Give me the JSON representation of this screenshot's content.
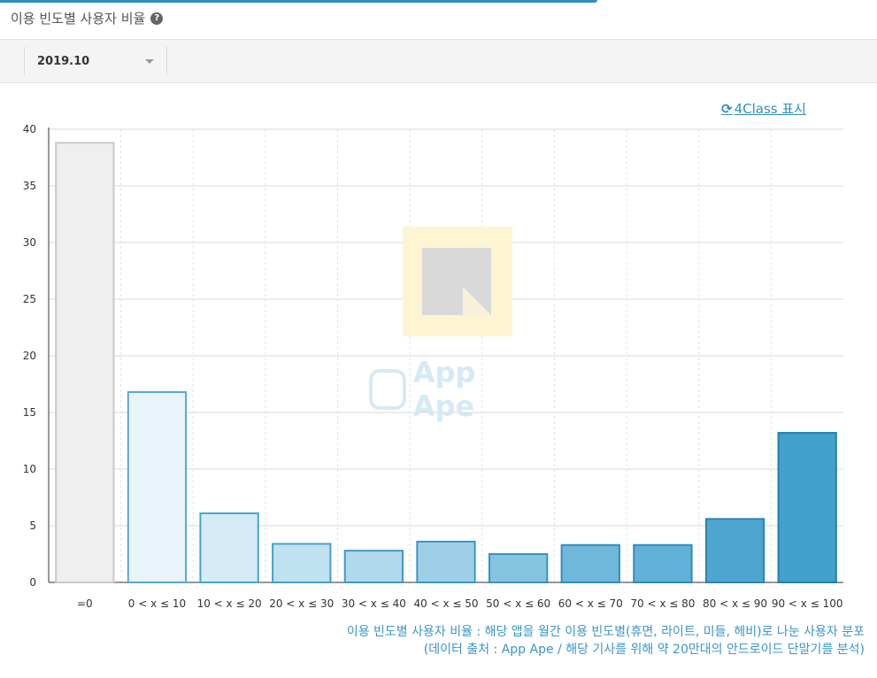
{
  "header": {
    "title": "이용 빈도별 사용자 비율",
    "help_icon": "?"
  },
  "toolbar": {
    "period_value": "2019.10"
  },
  "class_toggle": {
    "icon": "⟳",
    "label": "4Class 표시"
  },
  "watermark": {
    "logo_text": "App Ape"
  },
  "caption": {
    "line1": "이용 빈도별 사용자 비율 : 해당 앱을 월간 이용 빈도별(휴면, 라이트, 미들, 헤비)로 나눈 사용자 분포",
    "line2": "(데이터 출처 : App Ape / 해당 기사를 위해 약 20만대의 안드로이드 단말기를 분석)"
  },
  "chart_data": {
    "type": "bar",
    "title": "",
    "xlabel": "",
    "ylabel": "",
    "ylim": [
      0,
      40
    ],
    "yticks": [
      0,
      5,
      10,
      15,
      20,
      25,
      30,
      35,
      40
    ],
    "grid": true,
    "categories": [
      "=0",
      "0 < x ≤ 10",
      "10 < x ≤ 20",
      "20 < x ≤ 30",
      "30 < x ≤ 40",
      "40 < x ≤ 50",
      "50 < x ≤ 60",
      "60 < x ≤ 70",
      "70 < x ≤ 80",
      "80 < x ≤ 90",
      "90 < x ≤ 100"
    ],
    "values": [
      38.8,
      16.8,
      6.1,
      3.4,
      2.8,
      3.6,
      2.5,
      3.3,
      3.3,
      5.6,
      13.2
    ],
    "colors": [
      "#efefef",
      "#e8f4fa",
      "#d5ebf5",
      "#c0e1f0",
      "#b0d9ec",
      "#9ecfe7",
      "#86c3e0",
      "#70b8db",
      "#62b1d8",
      "#4ea6d0",
      "#41a0cc"
    ],
    "borders": [
      "#c9c9c9",
      "#55a9cf",
      "#4aa3cb",
      "#46a0c9",
      "#3f9ac4",
      "#3c97c2",
      "#3792bf",
      "#328dbc",
      "#2f8ab9",
      "#2a84b4",
      "#2680b0"
    ]
  }
}
